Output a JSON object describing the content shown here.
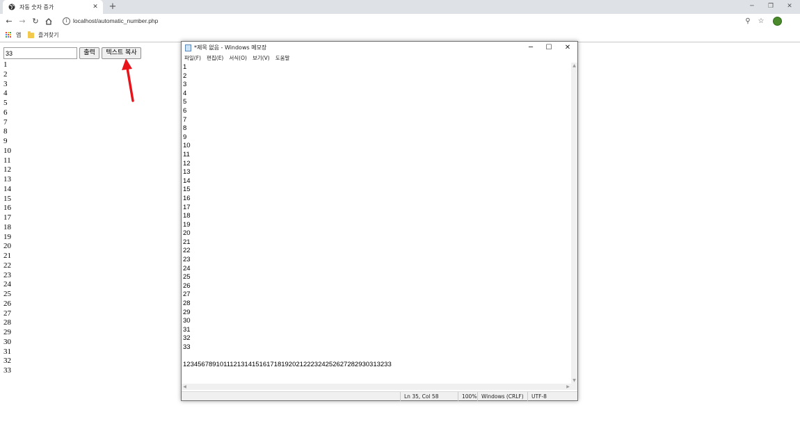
{
  "browser": {
    "tab_title": "자동 숫자 증가",
    "tab_close": "✕",
    "new_tab": "+",
    "url": "localhost/automatic_number.php",
    "bookmarks": {
      "apps_label": "앱",
      "favorites_label": "즐겨찾기"
    }
  },
  "page": {
    "number_input_value": "33",
    "print_button": "출력",
    "copy_button": "텍스트 복사",
    "output_lines": [
      "1",
      "2",
      "3",
      "4",
      "5",
      "6",
      "7",
      "8",
      "9",
      "10",
      "11",
      "12",
      "13",
      "14",
      "15",
      "16",
      "17",
      "18",
      "19",
      "20",
      "21",
      "22",
      "23",
      "24",
      "25",
      "26",
      "27",
      "28",
      "29",
      "30",
      "31",
      "32",
      "33"
    ]
  },
  "notepad": {
    "title": "*제목 없음 - Windows 메모장",
    "menu": [
      "파일(F)",
      "편집(E)",
      "서식(O)",
      "보기(V)",
      "도움말"
    ],
    "lines": [
      "1",
      "2",
      "3",
      "4",
      "5",
      "6",
      "7",
      "8",
      "9",
      "10",
      "11",
      "12",
      "13",
      "14",
      "15",
      "16",
      "17",
      "18",
      "19",
      "20",
      "21",
      "22",
      "23",
      "24",
      "25",
      "26",
      "27",
      "28",
      "29",
      "30",
      "31",
      "32",
      "33",
      "",
      "123456789101112131415161718192021222324252627282930313233"
    ],
    "status": {
      "position": "Ln 35, Col 58",
      "zoom": "100%",
      "line_ending": "Windows (CRLF)",
      "encoding": "UTF-8"
    }
  },
  "annotation": {
    "arrow_color": "#e8141b"
  }
}
